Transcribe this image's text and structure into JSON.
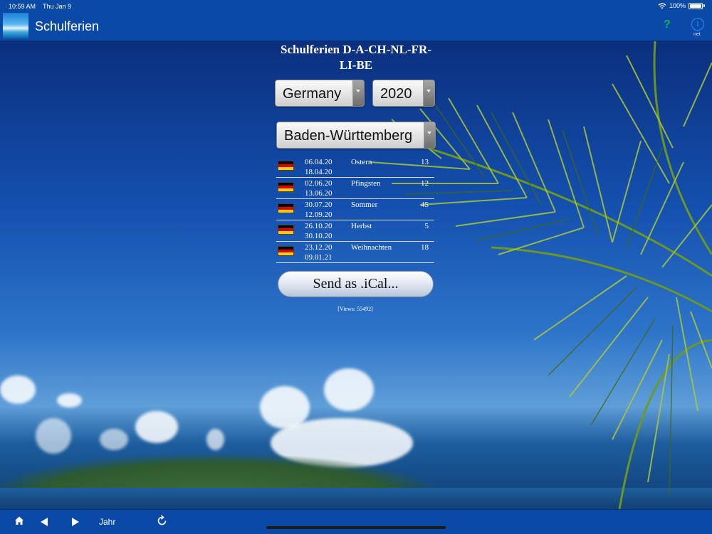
{
  "status_bar": {
    "time": "10:59 AM",
    "date": "Thu Jan 9",
    "battery": "100%"
  },
  "nav": {
    "title": "Schulferien",
    "help_label": "?",
    "info_label": "i",
    "net_label": "net"
  },
  "panel": {
    "title": "Schulferien D-A-CH-NL-FR-LI-BE",
    "country": "Germany",
    "year": "2020",
    "state": "Baden-Württemberg",
    "flag_colors": [
      "#000000",
      "#dd0000",
      "#ffce00"
    ],
    "holidays": [
      {
        "from": "06.04.20",
        "to": "18.04.20",
        "name": "Ostern",
        "days": "13"
      },
      {
        "from": "02.06.20",
        "to": "13.06.20",
        "name": "Pfingsten",
        "days": "12"
      },
      {
        "from": "30.07.20",
        "to": "12.09.20",
        "name": "Sommer",
        "days": "45"
      },
      {
        "from": "26.10.20",
        "to": "30.10.20",
        "name": "Herbst",
        "days": "5"
      },
      {
        "from": "23.12.20",
        "to": "09.01.21",
        "name": "Weihnachten",
        "days": "18"
      }
    ],
    "ical_button": "Send as .iCal...",
    "views": "[Views: 55492]"
  },
  "toolbar": {
    "home_icon": "home-icon",
    "prev_icon": "back-arrow-icon",
    "next_icon": "forward-arrow-icon",
    "jahr_label": "Jahr",
    "refresh_icon": "refresh-icon"
  }
}
